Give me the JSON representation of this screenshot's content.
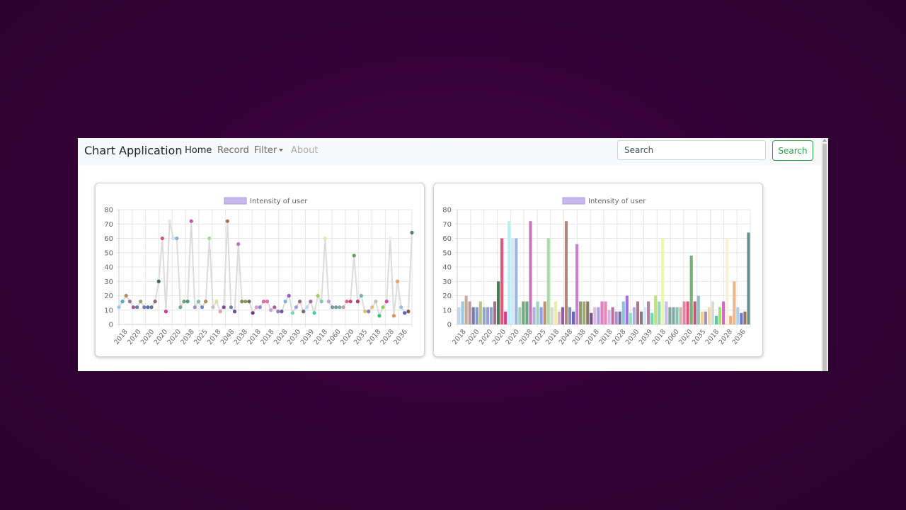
{
  "navbar": {
    "brand": "Chart Application",
    "items": [
      {
        "label": "Home",
        "state": "active"
      },
      {
        "label": "Record",
        "state": "normal"
      },
      {
        "label": "Filter",
        "state": "dropdown"
      },
      {
        "label": "About",
        "state": "disabled"
      }
    ],
    "search": {
      "placeholder": "Search",
      "value": "",
      "button_label": "Search"
    }
  },
  "chart_data": [
    {
      "type": "line",
      "legend": "Intensity of user",
      "legend_color": "#c9b8ee",
      "line_color": "#dcdcdc",
      "ylim": [
        0,
        80
      ],
      "yticks": [
        0,
        10,
        20,
        30,
        40,
        50,
        60,
        70,
        80
      ],
      "grid": true,
      "legend_position": "top",
      "x_tick_labels": [
        "2018",
        "2020",
        "2020",
        "2020",
        "2020",
        "2038",
        "2025",
        "2018",
        "2048",
        "2038",
        "2018",
        "2018",
        "2028",
        "2030",
        "2039",
        "2018",
        "2060",
        "2020",
        "2035",
        "2018",
        "2028",
        "2036"
      ],
      "values": [
        12,
        16,
        20,
        16,
        12,
        12,
        16,
        12,
        12,
        12,
        16,
        30,
        60,
        9,
        72,
        60,
        60,
        12,
        16,
        16,
        72,
        12,
        16,
        12,
        16,
        60,
        12,
        16,
        9,
        12,
        72,
        12,
        9,
        56,
        16,
        16,
        16,
        8,
        12,
        12,
        16,
        16,
        10,
        12,
        9,
        9,
        16,
        20,
        8,
        12,
        16,
        9,
        12,
        16,
        8,
        20,
        16,
        60,
        16,
        12,
        12,
        12,
        12,
        16,
        16,
        48,
        16,
        20,
        9,
        9,
        12,
        16,
        6,
        12,
        16,
        60,
        6,
        30,
        12,
        8,
        9,
        64
      ],
      "point_colors": [
        "#9dc6e3",
        "#4fa7c8",
        "#b48a6c",
        "#a36f8f",
        "#a05b8b",
        "#6c7aa0",
        "#a3a06c",
        "#6b7cc0",
        "#5a6fa0",
        "#6b6f90",
        "#9a5c8a",
        "#3f6b4c",
        "#e0506b",
        "#cc3ca0",
        "#d6f0f5",
        "#c9e3ef",
        "#8aaad8",
        "#6fa898",
        "#6a9e6a",
        "#4c9c7c",
        "#c050a0",
        "#9a8ec8",
        "#7fbca8",
        "#6f86d8",
        "#c07f54",
        "#a8d890",
        "#c0c0c0",
        "#d8e488",
        "#e0a0c0",
        "#7a4c9a",
        "#b07050",
        "#6a80a0",
        "#6a4cb0",
        "#c070c8",
        "#7a8a60",
        "#8a9a5a",
        "#7c6a5c",
        "#6a3c8a",
        "#d4a0d4",
        "#8a8ad4",
        "#e06ab0",
        "#e070a0",
        "#c0a0d8",
        "#b06090",
        "#9a7ab0",
        "#6a5c9a",
        "#7ab4d4",
        "#8a5cd0",
        "#7ad4b4",
        "#9c9cd0",
        "#9a6a7a",
        "#7a6a7a",
        "#c0d8e8",
        "#a06a9a",
        "#40d0a0",
        "#aad060",
        "#80c8a0",
        "#e0f0a0",
        "#c0a0e0",
        "#6a9a8a",
        "#7a9a9a",
        "#6ab4a0",
        "#c0a0a0",
        "#d07080",
        "#d04070",
        "#60a060",
        "#b04060",
        "#7ab0b0",
        "#e0c060",
        "#8a7ab0",
        "#e0c080",
        "#c0c0c0",
        "#30c080",
        "#8ad050",
        "#c050b0",
        "#f0f0f0",
        "#e09060",
        "#e0a070",
        "#90c0e0",
        "#5060c0",
        "#806040",
        "#508080"
      ]
    },
    {
      "type": "bar",
      "legend": "Intensity of user",
      "legend_color": "#c9b8ee",
      "ylim": [
        0,
        80
      ],
      "yticks": [
        0,
        10,
        20,
        30,
        40,
        50,
        60,
        70,
        80
      ],
      "grid": true,
      "legend_position": "top",
      "x_tick_labels": [
        "2018",
        "2020",
        "2020",
        "2020",
        "2020",
        "2038",
        "2025",
        "2018",
        "2048",
        "2038",
        "2018",
        "2018",
        "2028",
        "2030",
        "2039",
        "2018",
        "2060",
        "2020",
        "2035",
        "2018",
        "2028",
        "2036"
      ],
      "values": [
        12,
        16,
        20,
        16,
        12,
        12,
        16,
        12,
        12,
        12,
        16,
        30,
        60,
        9,
        72,
        60,
        60,
        12,
        16,
        16,
        72,
        12,
        16,
        12,
        16,
        60,
        12,
        16,
        9,
        12,
        72,
        12,
        9,
        56,
        16,
        16,
        16,
        8,
        12,
        12,
        16,
        16,
        10,
        12,
        9,
        9,
        16,
        20,
        8,
        12,
        16,
        9,
        12,
        16,
        8,
        20,
        16,
        60,
        16,
        12,
        12,
        12,
        12,
        16,
        16,
        48,
        16,
        20,
        9,
        9,
        12,
        16,
        6,
        12,
        16,
        60,
        6,
        30,
        12,
        8,
        9,
        64
      ],
      "bar_colors": [
        "#c6d6f2",
        "#9ac8e0",
        "#c8ac90",
        "#b89aa8",
        "#7a7aa8",
        "#8898c8",
        "#c0c080",
        "#8aa8c8",
        "#9a9ad8",
        "#90a0c8",
        "#a07090",
        "#507858",
        "#e8557a",
        "#d0408a",
        "#b8f0f8",
        "#d0e8f8",
        "#a0b4e0",
        "#a0d4b8",
        "#78a878",
        "#68a888",
        "#c878b8",
        "#b4b0e0",
        "#9cd4c0",
        "#90a0e8",
        "#c0906c",
        "#a8dca0",
        "#d8d8d8",
        "#e8f0a8",
        "#e8b0c8",
        "#8a60aa",
        "#b08878",
        "#8090b4",
        "#7060c0",
        "#c880d0",
        "#909a70",
        "#a0a870",
        "#8a7a6a",
        "#70508a",
        "#e0b8e0",
        "#a8a8e0",
        "#e080c0",
        "#e888b8",
        "#d0b8e8",
        "#c070a0",
        "#a890c0",
        "#7868a8",
        "#88c0e0",
        "#a070e0",
        "#90e0c0",
        "#b0b0e0",
        "#a87888",
        "#887888",
        "#d0e8f0",
        "#b080a8",
        "#60e0b0",
        "#c0e080",
        "#98d8b8",
        "#e8f8b0",
        "#d0b8f0",
        "#80a898",
        "#88a8a8",
        "#80c8b0",
        "#d0b0b0",
        "#e088a0",
        "#e05888",
        "#78b078",
        "#c05878",
        "#90c0c0",
        "#f0d080",
        "#a090c0",
        "#f0d8a0",
        "#d8d8d8",
        "#50d098",
        "#a0e070",
        "#d068c0",
        "#f8f0d8",
        "#f0a878",
        "#f0b888",
        "#a8d0f0",
        "#6878d0",
        "#987858",
        "#689090"
      ]
    }
  ]
}
